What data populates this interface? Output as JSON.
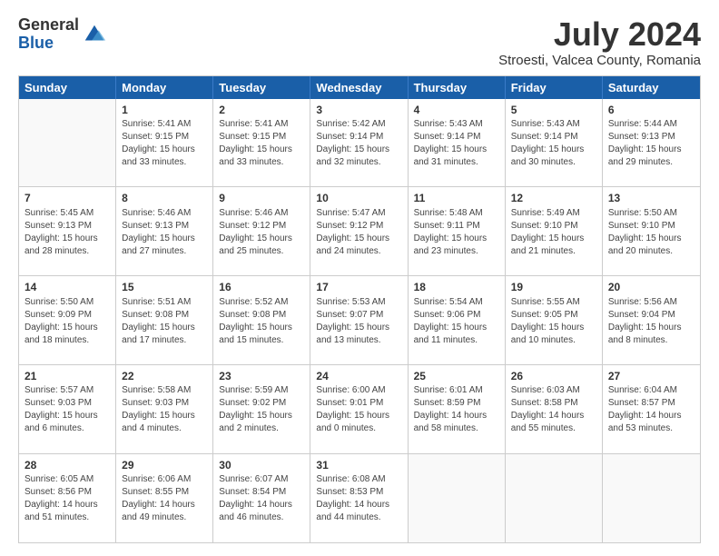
{
  "logo": {
    "general": "General",
    "blue": "Blue"
  },
  "title": {
    "month_year": "July 2024",
    "location": "Stroesti, Valcea County, Romania"
  },
  "header_days": [
    "Sunday",
    "Monday",
    "Tuesday",
    "Wednesday",
    "Thursday",
    "Friday",
    "Saturday"
  ],
  "weeks": [
    [
      {
        "day": "",
        "empty": true
      },
      {
        "day": "1",
        "sunrise": "Sunrise: 5:41 AM",
        "sunset": "Sunset: 9:15 PM",
        "daylight": "Daylight: 15 hours and 33 minutes."
      },
      {
        "day": "2",
        "sunrise": "Sunrise: 5:41 AM",
        "sunset": "Sunset: 9:15 PM",
        "daylight": "Daylight: 15 hours and 33 minutes."
      },
      {
        "day": "3",
        "sunrise": "Sunrise: 5:42 AM",
        "sunset": "Sunset: 9:14 PM",
        "daylight": "Daylight: 15 hours and 32 minutes."
      },
      {
        "day": "4",
        "sunrise": "Sunrise: 5:43 AM",
        "sunset": "Sunset: 9:14 PM",
        "daylight": "Daylight: 15 hours and 31 minutes."
      },
      {
        "day": "5",
        "sunrise": "Sunrise: 5:43 AM",
        "sunset": "Sunset: 9:14 PM",
        "daylight": "Daylight: 15 hours and 30 minutes."
      },
      {
        "day": "6",
        "sunrise": "Sunrise: 5:44 AM",
        "sunset": "Sunset: 9:13 PM",
        "daylight": "Daylight: 15 hours and 29 minutes."
      }
    ],
    [
      {
        "day": "7",
        "sunrise": "Sunrise: 5:45 AM",
        "sunset": "Sunset: 9:13 PM",
        "daylight": "Daylight: 15 hours and 28 minutes."
      },
      {
        "day": "8",
        "sunrise": "Sunrise: 5:46 AM",
        "sunset": "Sunset: 9:13 PM",
        "daylight": "Daylight: 15 hours and 27 minutes."
      },
      {
        "day": "9",
        "sunrise": "Sunrise: 5:46 AM",
        "sunset": "Sunset: 9:12 PM",
        "daylight": "Daylight: 15 hours and 25 minutes."
      },
      {
        "day": "10",
        "sunrise": "Sunrise: 5:47 AM",
        "sunset": "Sunset: 9:12 PM",
        "daylight": "Daylight: 15 hours and 24 minutes."
      },
      {
        "day": "11",
        "sunrise": "Sunrise: 5:48 AM",
        "sunset": "Sunset: 9:11 PM",
        "daylight": "Daylight: 15 hours and 23 minutes."
      },
      {
        "day": "12",
        "sunrise": "Sunrise: 5:49 AM",
        "sunset": "Sunset: 9:10 PM",
        "daylight": "Daylight: 15 hours and 21 minutes."
      },
      {
        "day": "13",
        "sunrise": "Sunrise: 5:50 AM",
        "sunset": "Sunset: 9:10 PM",
        "daylight": "Daylight: 15 hours and 20 minutes."
      }
    ],
    [
      {
        "day": "14",
        "sunrise": "Sunrise: 5:50 AM",
        "sunset": "Sunset: 9:09 PM",
        "daylight": "Daylight: 15 hours and 18 minutes."
      },
      {
        "day": "15",
        "sunrise": "Sunrise: 5:51 AM",
        "sunset": "Sunset: 9:08 PM",
        "daylight": "Daylight: 15 hours and 17 minutes."
      },
      {
        "day": "16",
        "sunrise": "Sunrise: 5:52 AM",
        "sunset": "Sunset: 9:08 PM",
        "daylight": "Daylight: 15 hours and 15 minutes."
      },
      {
        "day": "17",
        "sunrise": "Sunrise: 5:53 AM",
        "sunset": "Sunset: 9:07 PM",
        "daylight": "Daylight: 15 hours and 13 minutes."
      },
      {
        "day": "18",
        "sunrise": "Sunrise: 5:54 AM",
        "sunset": "Sunset: 9:06 PM",
        "daylight": "Daylight: 15 hours and 11 minutes."
      },
      {
        "day": "19",
        "sunrise": "Sunrise: 5:55 AM",
        "sunset": "Sunset: 9:05 PM",
        "daylight": "Daylight: 15 hours and 10 minutes."
      },
      {
        "day": "20",
        "sunrise": "Sunrise: 5:56 AM",
        "sunset": "Sunset: 9:04 PM",
        "daylight": "Daylight: 15 hours and 8 minutes."
      }
    ],
    [
      {
        "day": "21",
        "sunrise": "Sunrise: 5:57 AM",
        "sunset": "Sunset: 9:03 PM",
        "daylight": "Daylight: 15 hours and 6 minutes."
      },
      {
        "day": "22",
        "sunrise": "Sunrise: 5:58 AM",
        "sunset": "Sunset: 9:03 PM",
        "daylight": "Daylight: 15 hours and 4 minutes."
      },
      {
        "day": "23",
        "sunrise": "Sunrise: 5:59 AM",
        "sunset": "Sunset: 9:02 PM",
        "daylight": "Daylight: 15 hours and 2 minutes."
      },
      {
        "day": "24",
        "sunrise": "Sunrise: 6:00 AM",
        "sunset": "Sunset: 9:01 PM",
        "daylight": "Daylight: 15 hours and 0 minutes."
      },
      {
        "day": "25",
        "sunrise": "Sunrise: 6:01 AM",
        "sunset": "Sunset: 8:59 PM",
        "daylight": "Daylight: 14 hours and 58 minutes."
      },
      {
        "day": "26",
        "sunrise": "Sunrise: 6:03 AM",
        "sunset": "Sunset: 8:58 PM",
        "daylight": "Daylight: 14 hours and 55 minutes."
      },
      {
        "day": "27",
        "sunrise": "Sunrise: 6:04 AM",
        "sunset": "Sunset: 8:57 PM",
        "daylight": "Daylight: 14 hours and 53 minutes."
      }
    ],
    [
      {
        "day": "28",
        "sunrise": "Sunrise: 6:05 AM",
        "sunset": "Sunset: 8:56 PM",
        "daylight": "Daylight: 14 hours and 51 minutes."
      },
      {
        "day": "29",
        "sunrise": "Sunrise: 6:06 AM",
        "sunset": "Sunset: 8:55 PM",
        "daylight": "Daylight: 14 hours and 49 minutes."
      },
      {
        "day": "30",
        "sunrise": "Sunrise: 6:07 AM",
        "sunset": "Sunset: 8:54 PM",
        "daylight": "Daylight: 14 hours and 46 minutes."
      },
      {
        "day": "31",
        "sunrise": "Sunrise: 6:08 AM",
        "sunset": "Sunset: 8:53 PM",
        "daylight": "Daylight: 14 hours and 44 minutes."
      },
      {
        "day": "",
        "empty": true
      },
      {
        "day": "",
        "empty": true
      },
      {
        "day": "",
        "empty": true
      }
    ]
  ]
}
